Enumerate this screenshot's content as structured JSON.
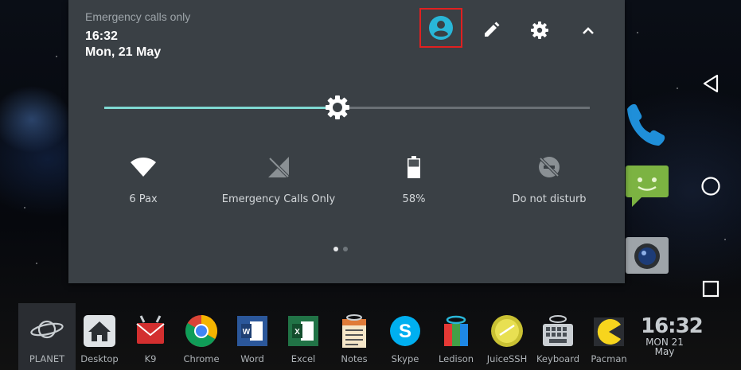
{
  "status": {
    "carrier_text": "Emergency calls only",
    "time": "16:32",
    "date": "Mon, 21 May"
  },
  "header_icons": [
    "user-account-icon",
    "edit-pencil-icon",
    "settings-gear-icon",
    "collapse-chevron-icon"
  ],
  "brightness": {
    "level": 0.48,
    "accent": "#7fd9d2"
  },
  "tiles": [
    {
      "label": "6 Pax",
      "icon": "wifi-icon"
    },
    {
      "label": "Emergency Calls Only",
      "icon": "no-signal-icon"
    },
    {
      "label": "58%",
      "icon": "battery-icon"
    },
    {
      "label": "Do not disturb",
      "icon": "do-not-disturb-icon"
    }
  ],
  "pager": {
    "pages": 2,
    "current": 1
  },
  "dock": {
    "items": [
      {
        "label": "PLANET",
        "icon": "planet-icon"
      },
      {
        "label": "Desktop",
        "icon": "home-icon"
      },
      {
        "label": "K9",
        "icon": "k9-mail-icon"
      },
      {
        "label": "Chrome",
        "icon": "chrome-icon"
      },
      {
        "label": "Word",
        "icon": "word-icon"
      },
      {
        "label": "Excel",
        "icon": "excel-icon"
      },
      {
        "label": "Notes",
        "icon": "notes-icon"
      },
      {
        "label": "Skype",
        "icon": "skype-icon"
      },
      {
        "label": "Ledison",
        "icon": "ledison-icon"
      },
      {
        "label": "JuiceSSH",
        "icon": "juicessh-icon"
      },
      {
        "label": "Keyboard",
        "icon": "keyboard-icon"
      },
      {
        "label": "Pacman",
        "icon": "pacman-icon"
      }
    ],
    "clock": {
      "time": "16:32",
      "day": "MON  21",
      "month": "May"
    }
  },
  "nav": [
    "back-icon",
    "home-circle-icon",
    "recents-square-icon"
  ],
  "colors": {
    "shade_bg": "#3a4045",
    "highlight_box": "#e02020",
    "user_icon": "#29b6d8"
  }
}
